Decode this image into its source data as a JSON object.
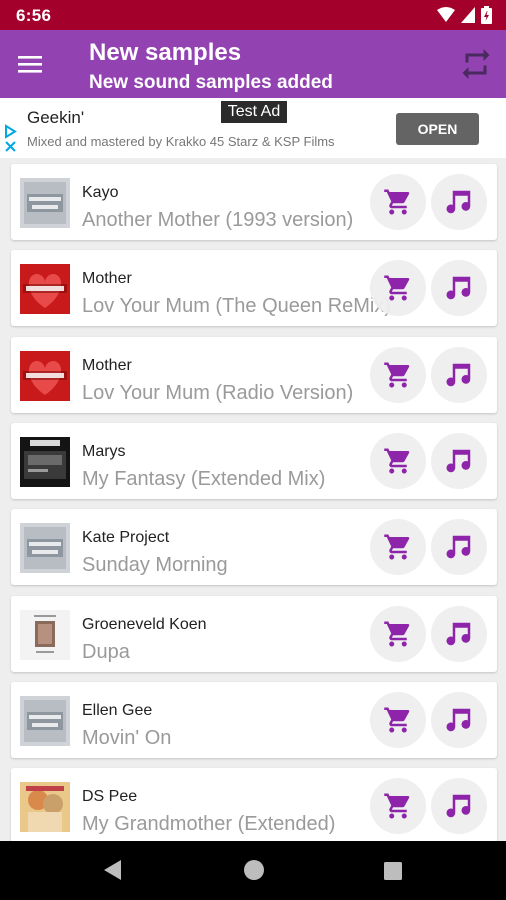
{
  "status_bar": {
    "time": "6:56"
  },
  "app_bar": {
    "title": "New samples",
    "subtitle": "New sound samples added"
  },
  "ad": {
    "badge": "Test Ad",
    "title": "Geekin'",
    "description": "Mixed and mastered by Krakko 45 Starz & KSP Films",
    "button": "OPEN"
  },
  "colors": {
    "status_bar": "#a3002c",
    "app_bar": "#9343b1",
    "accent_purple": "#8e24aa"
  },
  "icons": {
    "menu": "menu-icon",
    "refresh": "repeat-icon",
    "cart": "shopping-cart-icon",
    "music": "music-note-icon"
  },
  "samples": [
    {
      "artist": "Kayo",
      "track": "Another Mother (1993 version)",
      "artwork": "missing-sleeve"
    },
    {
      "artist": "Mother",
      "track": "Lov Your Mum (The Queen ReMix)",
      "artwork": "mother"
    },
    {
      "artist": "Mother",
      "track": "Lov Your Mum (Radio Version)",
      "artwork": "mother"
    },
    {
      "artist": "Marys",
      "track": "My Fantasy (Extended Mix)",
      "artwork": "marys"
    },
    {
      "artist": "Kate Project",
      "track": "Sunday Morning",
      "artwork": "missing-sleeve"
    },
    {
      "artist": "Groeneveld Koen",
      "track": "Dupa",
      "artwork": "groeneveld"
    },
    {
      "artist": "Ellen Gee",
      "track": "Movin' On",
      "artwork": "missing-sleeve"
    },
    {
      "artist": "DS Pee",
      "track": "My Grandmother (Extended)",
      "artwork": "ds-pee"
    }
  ]
}
